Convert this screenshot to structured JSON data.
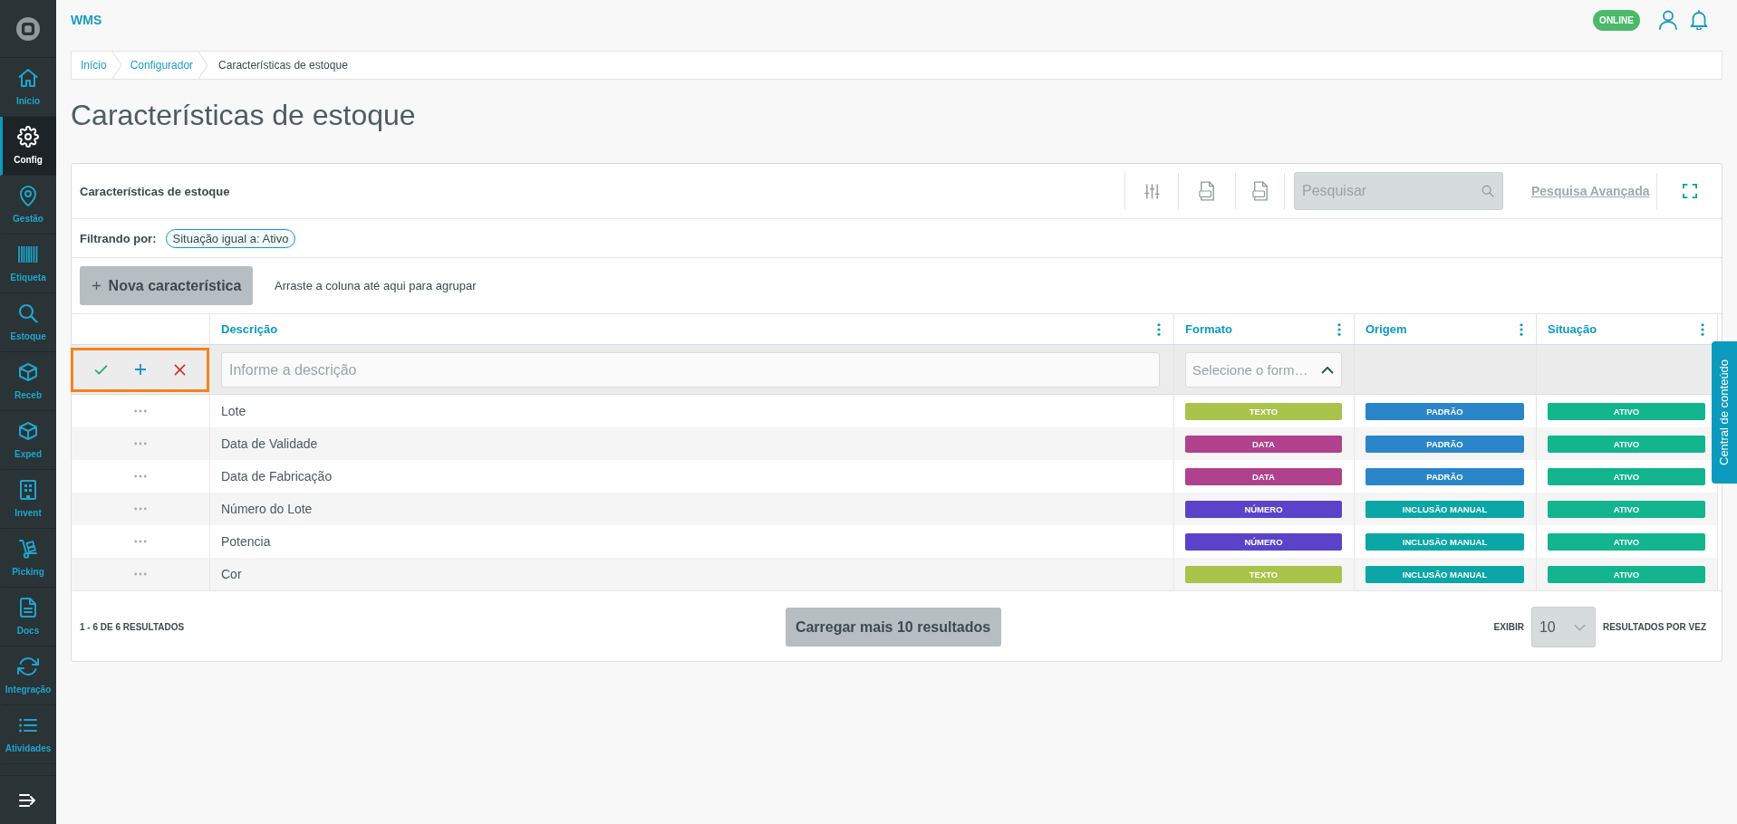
{
  "header": {
    "app_name": "WMS",
    "status": "ONLINE"
  },
  "sidebar": {
    "items": [
      {
        "label": "Início",
        "selected": false
      },
      {
        "label": "Config",
        "selected": true
      },
      {
        "label": "Gestão",
        "selected": false
      },
      {
        "label": "Etiqueta",
        "selected": false
      },
      {
        "label": "Estoque",
        "selected": false
      },
      {
        "label": "Receb",
        "selected": false
      },
      {
        "label": "Exped",
        "selected": false
      },
      {
        "label": "Invent",
        "selected": false
      },
      {
        "label": "Picking",
        "selected": false
      },
      {
        "label": "Docs",
        "selected": false
      },
      {
        "label": "Integração",
        "selected": false
      },
      {
        "label": "Atividades",
        "selected": false
      }
    ]
  },
  "breadcrumb": [
    {
      "label": "Início",
      "current": false
    },
    {
      "label": "Configurador",
      "current": false
    },
    {
      "label": "Características de estoque",
      "current": true
    }
  ],
  "page_title": "Características de estoque",
  "grid": {
    "title": "Características de estoque",
    "search": {
      "placeholder": "Pesquisar"
    },
    "advanced_search": "Pesquisa Avançada",
    "filter": {
      "label": "Filtrando por:",
      "chips": [
        "Situação igual a: Ativo"
      ]
    },
    "new_button": "Nova característica",
    "group_hint": "Arraste a coluna até aqui para agrupar",
    "columns": [
      "Descrição",
      "Formato",
      "Origem",
      "Situação"
    ],
    "new_row": {
      "description": {
        "placeholder": "Informe a descrição"
      },
      "format": {
        "placeholder": "Selecione o form…"
      }
    },
    "rows": [
      {
        "description": "Lote",
        "format": {
          "label": "TEXTO",
          "color": "#a9c34b"
        },
        "origin": {
          "label": "PADRÃO",
          "color": "#2b86c9"
        },
        "status": {
          "label": "ATIVO",
          "color": "#12b58e"
        }
      },
      {
        "description": "Data de Validade",
        "format": {
          "label": "DATA",
          "color": "#b0418d"
        },
        "origin": {
          "label": "PADRÃO",
          "color": "#2b86c9"
        },
        "status": {
          "label": "ATIVO",
          "color": "#12b58e"
        }
      },
      {
        "description": "Data de Fabricação",
        "format": {
          "label": "DATA",
          "color": "#b0418d"
        },
        "origin": {
          "label": "PADRÃO",
          "color": "#2b86c9"
        },
        "status": {
          "label": "ATIVO",
          "color": "#12b58e"
        }
      },
      {
        "description": "Número do Lote",
        "format": {
          "label": "NÚMERO",
          "color": "#5a43c9"
        },
        "origin": {
          "label": "INCLUSÃO MANUAL",
          "color": "#0ba6a6"
        },
        "status": {
          "label": "ATIVO",
          "color": "#12b58e"
        }
      },
      {
        "description": "Potencia",
        "format": {
          "label": "NÚMERO",
          "color": "#5a43c9"
        },
        "origin": {
          "label": "INCLUSÃO MANUAL",
          "color": "#0ba6a6"
        },
        "status": {
          "label": "ATIVO",
          "color": "#12b58e"
        }
      },
      {
        "description": "Cor",
        "format": {
          "label": "TEXTO",
          "color": "#a9c34b"
        },
        "origin": {
          "label": "INCLUSÃO MANUAL",
          "color": "#0ba6a6"
        },
        "status": {
          "label": "ATIVO",
          "color": "#12b58e"
        }
      }
    ],
    "footer": {
      "count": "1 - 6 DE 6 RESULTADOS",
      "load_more": "Carregar mais 10 resultados",
      "page_size_label": "EXIBIR",
      "page_size": "10",
      "page_size_suffix": "RESULTADOS POR VEZ"
    }
  },
  "side_tab": "Central de conteúdo"
}
